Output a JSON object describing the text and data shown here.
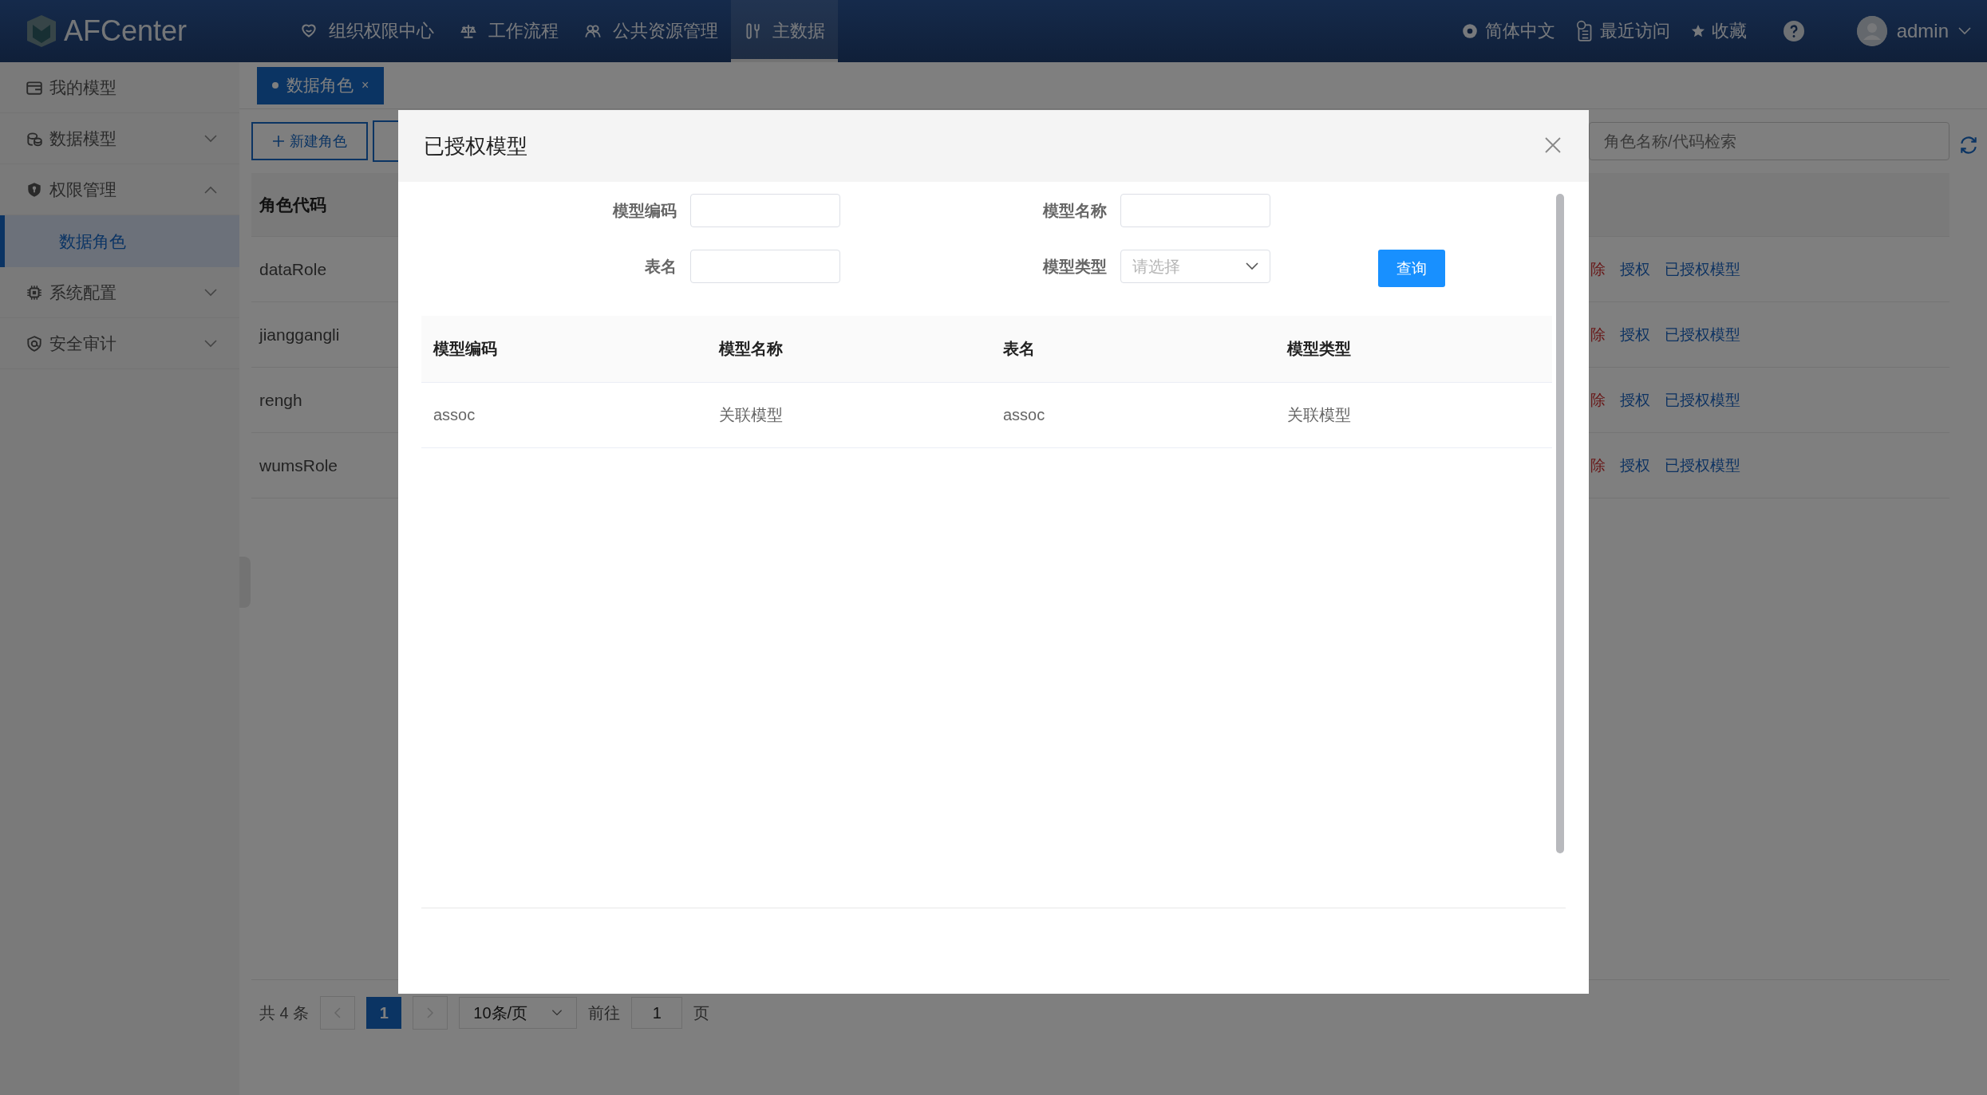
{
  "header": {
    "logo": "AFCenter",
    "nav": [
      {
        "label": "组织权限中心",
        "selected": false
      },
      {
        "label": "工作流程",
        "selected": false
      },
      {
        "label": "公共资源管理",
        "selected": false
      },
      {
        "label": "主数据",
        "selected": true
      }
    ],
    "language": "简体中文",
    "recent": "最近访问",
    "favorites": "收藏",
    "user": "admin"
  },
  "sidebar": {
    "items": [
      {
        "label": "我的模型",
        "kind": "link"
      },
      {
        "label": "数据模型",
        "kind": "group",
        "expanded": false
      },
      {
        "label": "权限管理",
        "kind": "group",
        "expanded": true,
        "children": [
          {
            "label": "数据角色",
            "selected": true
          }
        ]
      },
      {
        "label": "系统配置",
        "kind": "group",
        "expanded": false
      },
      {
        "label": "安全审计",
        "kind": "group",
        "expanded": false
      }
    ]
  },
  "tabs": [
    {
      "label": "数据角色",
      "selected": true,
      "close": "×"
    }
  ],
  "toolbar": {
    "new_button": "新建角色",
    "search": {
      "placeholder": "角色名称/代码检索"
    }
  },
  "table": {
    "columns": [
      "角色代码"
    ],
    "rows": [
      {
        "code": "dataRole",
        "actions": [
          {
            "label": "除",
            "kind": "danger"
          },
          {
            "label": "授权",
            "kind": "link"
          },
          {
            "label": "已授权模型",
            "kind": "link"
          }
        ]
      },
      {
        "code": "jianggangli",
        "actions": [
          {
            "label": "除",
            "kind": "danger"
          },
          {
            "label": "授权",
            "kind": "link"
          },
          {
            "label": "已授权模型",
            "kind": "link"
          }
        ]
      },
      {
        "code": "rengh",
        "actions": [
          {
            "label": "除",
            "kind": "danger"
          },
          {
            "label": "授权",
            "kind": "link"
          },
          {
            "label": "已授权模型",
            "kind": "link"
          }
        ]
      },
      {
        "code": "wumsRole",
        "actions": [
          {
            "label": "除",
            "kind": "danger"
          },
          {
            "label": "授权",
            "kind": "link"
          },
          {
            "label": "已授权模型",
            "kind": "link"
          }
        ]
      }
    ]
  },
  "pagination": {
    "total": "共 4 条",
    "pages": [
      {
        "label": "1",
        "selected": true
      }
    ],
    "page_size": "10条/页",
    "goto_label": "前往",
    "goto_value": "1",
    "page_suffix": "页"
  },
  "dialog": {
    "title": "已授权模型",
    "filters": [
      {
        "label": "模型编码",
        "kind": "input"
      },
      {
        "label": "模型名称",
        "kind": "input"
      },
      {
        "label": "表名",
        "kind": "input"
      },
      {
        "label": "模型类型",
        "kind": "select",
        "placeholder": "请选择"
      }
    ],
    "query_button": "查询",
    "table": {
      "columns": [
        "模型编码",
        "模型名称",
        "表名",
        "模型类型"
      ],
      "rows": [
        [
          "assoc",
          "关联模型",
          "assoc",
          "关联模型"
        ]
      ]
    }
  }
}
